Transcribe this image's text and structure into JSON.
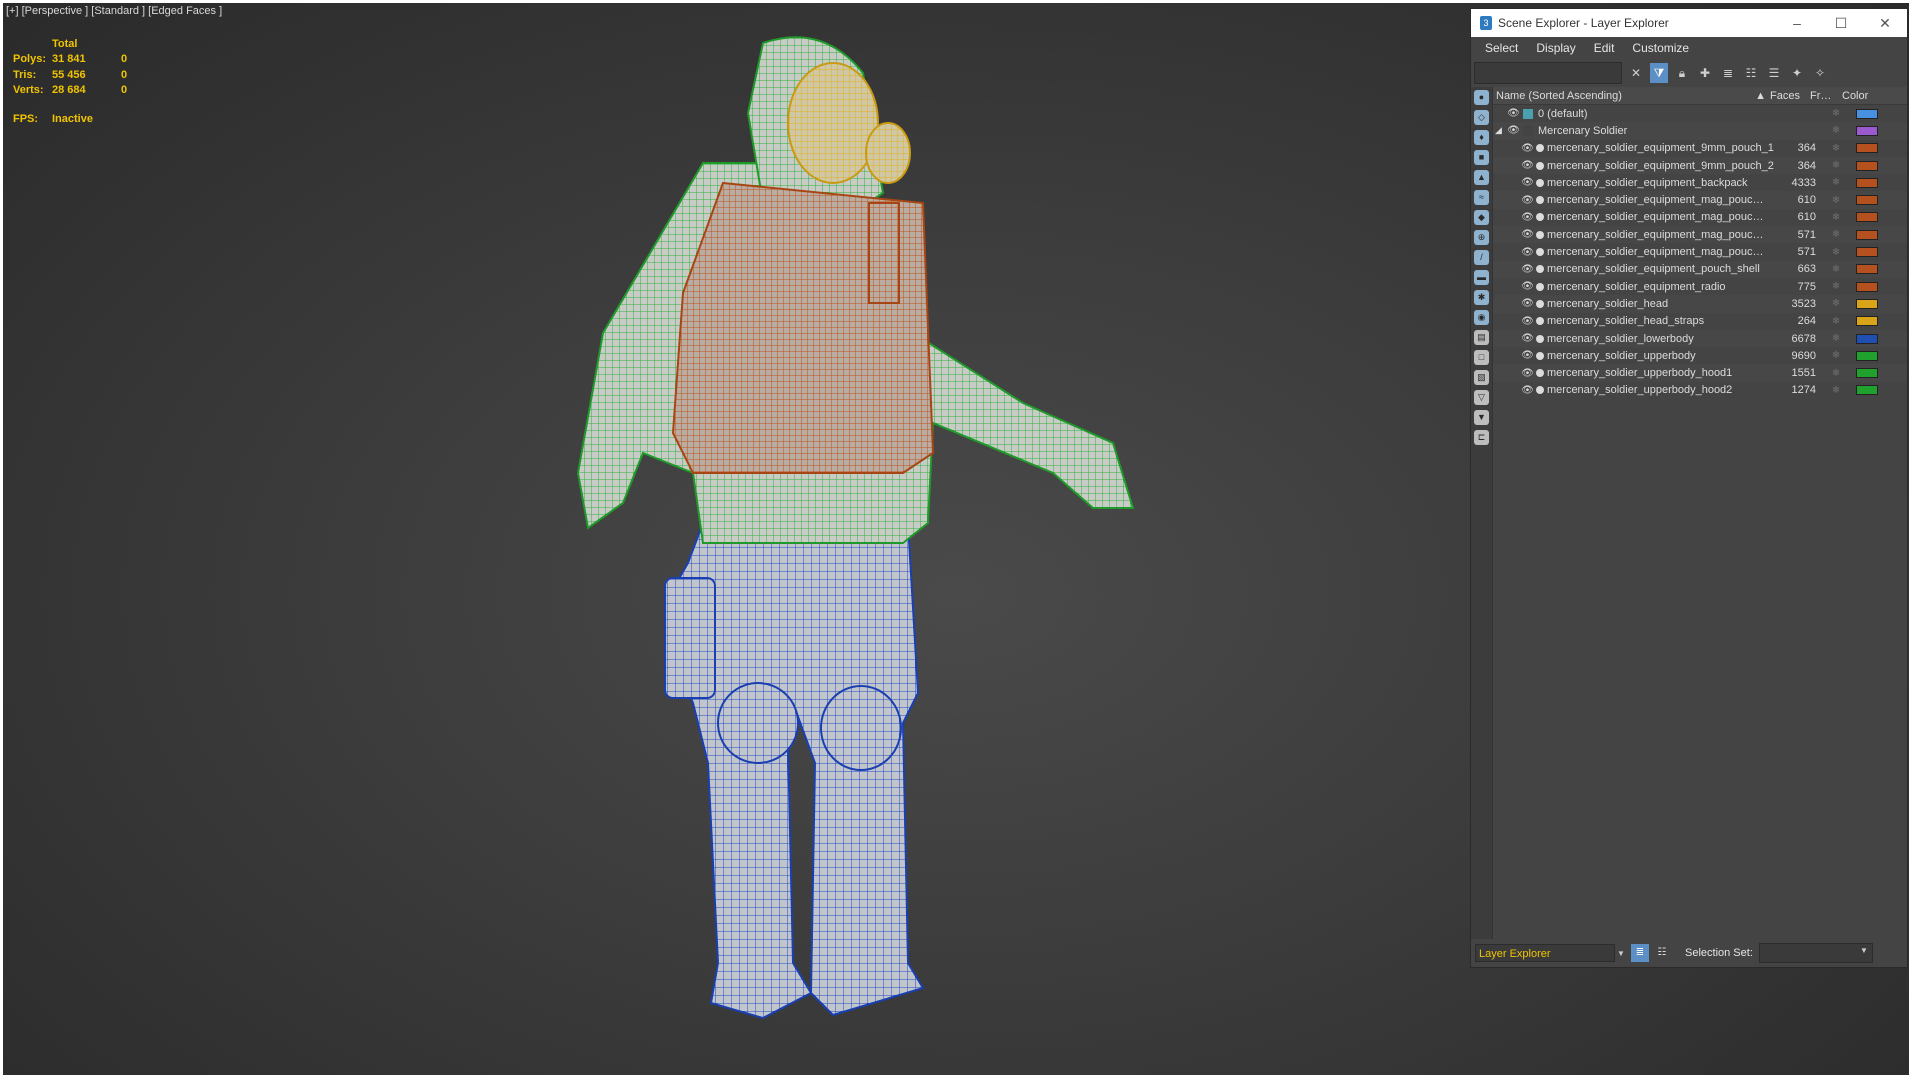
{
  "viewport": {
    "label": "[+] [Perspective ] [Standard ] [Edged Faces ]",
    "stats": {
      "header": "Total",
      "rows": [
        {
          "label": "Polys:",
          "total": "31 841",
          "sel": "0"
        },
        {
          "label": "Tris:",
          "total": "55 456",
          "sel": "0"
        },
        {
          "label": "Verts:",
          "total": "28 684",
          "sel": "0"
        }
      ],
      "fps_label": "FPS:",
      "fps_value": "Inactive"
    }
  },
  "explorer": {
    "title": "Scene Explorer - Layer Explorer",
    "app_icon": "3",
    "window_controls": [
      "–",
      "☐",
      "✕"
    ],
    "menu": [
      "Select",
      "Display",
      "Edit",
      "Customize"
    ],
    "search_placeholder": "",
    "columns": {
      "name": "Name (Sorted Ascending)",
      "sort_glyph": "▲",
      "faces": "Faces",
      "frozen": "Fr…",
      "color": "Color"
    },
    "rows": [
      {
        "name": "0 (default)",
        "faces": "",
        "color": "#4a90e2",
        "kind": "layer"
      },
      {
        "name": "Mercenary Soldier",
        "faces": "",
        "color": "#9b59d0",
        "kind": "group"
      },
      {
        "name": "mercenary_soldier_equipment_9mm_pouch_1",
        "faces": "364",
        "color": "#b4511f",
        "kind": "object"
      },
      {
        "name": "mercenary_soldier_equipment_9mm_pouch_2",
        "faces": "364",
        "color": "#b4511f",
        "kind": "object"
      },
      {
        "name": "mercenary_soldier_equipment_backpack",
        "faces": "4333",
        "color": "#b4511f",
        "kind": "object"
      },
      {
        "name": "mercenary_soldier_equipment_mag_pouc…",
        "faces": "610",
        "color": "#b4511f",
        "kind": "object"
      },
      {
        "name": "mercenary_soldier_equipment_mag_pouc…",
        "faces": "610",
        "color": "#b4511f",
        "kind": "object"
      },
      {
        "name": "mercenary_soldier_equipment_mag_pouc…",
        "faces": "571",
        "color": "#b4511f",
        "kind": "object"
      },
      {
        "name": "mercenary_soldier_equipment_mag_pouc…",
        "faces": "571",
        "color": "#b4511f",
        "kind": "object"
      },
      {
        "name": "mercenary_soldier_equipment_pouch_shell",
        "faces": "663",
        "color": "#b4511f",
        "kind": "object"
      },
      {
        "name": "mercenary_soldier_equipment_radio",
        "faces": "775",
        "color": "#b4511f",
        "kind": "object"
      },
      {
        "name": "mercenary_soldier_head",
        "faces": "3523",
        "color": "#d9a418",
        "kind": "object"
      },
      {
        "name": "mercenary_soldier_head_straps",
        "faces": "264",
        "color": "#d9a418",
        "kind": "object"
      },
      {
        "name": "mercenary_soldier_lowerbody",
        "faces": "6678",
        "color": "#1f4fb0",
        "kind": "object"
      },
      {
        "name": "mercenary_soldier_upperbody",
        "faces": "9690",
        "color": "#20a02c",
        "kind": "object"
      },
      {
        "name": "mercenary_soldier_upperbody_hood1",
        "faces": "1551",
        "color": "#20a02c",
        "kind": "object"
      },
      {
        "name": "mercenary_soldier_upperbody_hood2",
        "faces": "1274",
        "color": "#20a02c",
        "kind": "object"
      }
    ],
    "bottom": {
      "explorer_name": "Layer Explorer",
      "selection_set_label": "Selection Set:",
      "selection_set_value": ""
    }
  }
}
